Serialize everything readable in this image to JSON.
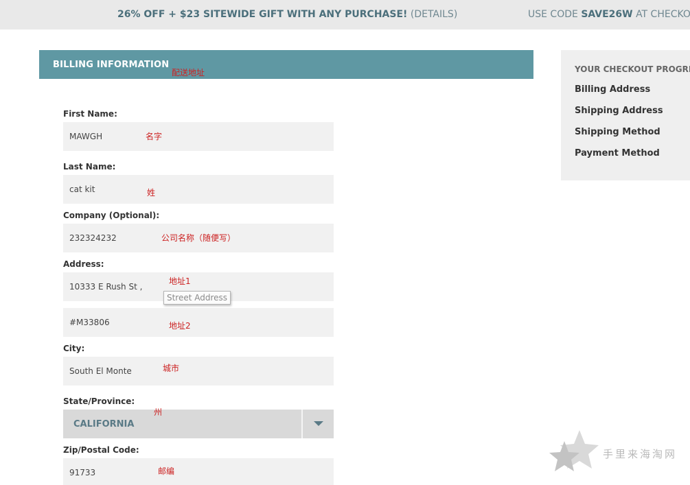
{
  "promo": {
    "offer_bold": "26% OFF + $23 SITEWIDE GIFT WITH ANY PURCHASE!",
    "details": "(DETAILS)",
    "code_prefix": "USE CODE",
    "code": "SAVE26W",
    "code_suffix": "AT CHECKO"
  },
  "billing": {
    "title": "BILLING INFORMATION",
    "title_note": "配送地址"
  },
  "form": {
    "first_name": {
      "label": "First Name:",
      "value": "MAWGH",
      "note": "名字"
    },
    "last_name": {
      "label": "Last Name:",
      "value": "cat kit",
      "note": "姓"
    },
    "company": {
      "label": "Company (Optional):",
      "value": "232324232",
      "note": "公司名称（随便写）"
    },
    "address": {
      "label": "Address:",
      "line1": "10333 E Rush St ,",
      "line1_note": "地址1",
      "tooltip": "Street Address",
      "line2": "#M33806",
      "line2_note": "地址2"
    },
    "city": {
      "label": "City:",
      "value": "South El Monte",
      "note": "城市"
    },
    "state": {
      "label": "State/Province:",
      "value": "CALIFORNIA",
      "note": "州"
    },
    "zip": {
      "label": "Zip/Postal Code:",
      "value": "91733",
      "note": "邮编"
    }
  },
  "progress": {
    "title": "YOUR CHECKOUT PROGRE",
    "steps": [
      "Billing Address",
      "Shipping Address",
      "Shipping Method",
      "Payment Method"
    ]
  },
  "watermark": {
    "text": "手里来海淘网"
  },
  "colors": {
    "header_teal": "#5f98a3",
    "promo_bg": "#e9e9e9",
    "field_bg": "#f1f1f1",
    "annotation_red": "#cc2222"
  }
}
